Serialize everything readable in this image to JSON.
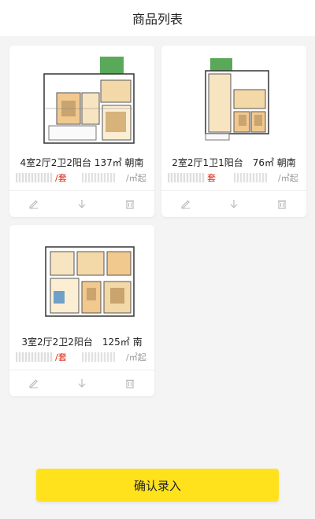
{
  "header": {
    "title": "商品列表"
  },
  "cards": [
    {
      "title": "4室2厅2卫2阳台 137㎡ 朝南",
      "price_unit": "/套",
      "area_unit": "/㎡起"
    },
    {
      "title": "2室2厅1卫1阳台　76㎡ 朝南",
      "price_unit": "套",
      "area_unit": "/㎡起"
    },
    {
      "title": "3室2厅2卫2阳台　125㎡ 南",
      "price_unit": "/套",
      "area_unit": "/㎡起"
    }
  ],
  "icons": {
    "edit": "pencil-icon",
    "download": "arrow-down-icon",
    "delete": "trash-icon"
  },
  "footer": {
    "confirm_label": "确认录入"
  },
  "colors": {
    "accent": "#ffe21c",
    "price": "#d81e06"
  }
}
